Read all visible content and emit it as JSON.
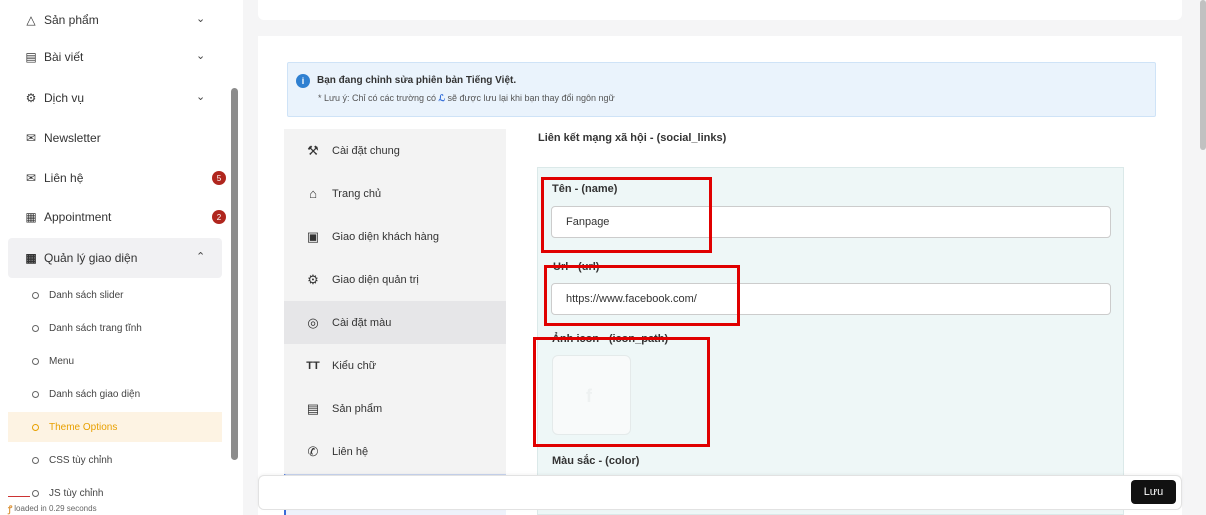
{
  "sidebar": {
    "items": [
      {
        "label": "Sản phẩm",
        "icon": "shapes-icon"
      },
      {
        "label": "Bài viết",
        "icon": "article-icon"
      },
      {
        "label": "Dịch vụ",
        "icon": "services-icon"
      },
      {
        "label": "Newsletter",
        "icon": "mail-icon"
      },
      {
        "label": "Liên hệ",
        "icon": "mail-icon",
        "badge": "5"
      },
      {
        "label": "Appointment",
        "icon": "calendar-icon",
        "badge": "2"
      },
      {
        "label": "Quản lý giao diện",
        "icon": "grid-icon"
      }
    ],
    "subitems": [
      "Danh sách slider",
      "Danh sách trang tĩnh",
      "Menu",
      "Danh sách giao diện",
      "Theme Options",
      "CSS tùy chỉnh",
      "JS tùy chỉnh"
    ],
    "active_subitem": "Theme Options",
    "loaded_text": "loaded in 0.29 seconds"
  },
  "info": {
    "title": "Bạn đang chỉnh sửa phiên bản Tiếng Việt.",
    "note_prefix": "* Lưu ý: Chỉ có các trường có",
    "note_suffix": "sẽ được lưu lại khi bạn thay đổi ngôn ngữ"
  },
  "settings_nav": [
    {
      "label": "Cài đặt chung",
      "icon": "wrench-icon"
    },
    {
      "label": "Trang chủ",
      "icon": "home-icon"
    },
    {
      "label": "Giao diện khách hàng",
      "icon": "image-icon"
    },
    {
      "label": "Giao diện quản trị",
      "icon": "settings-box-icon"
    },
    {
      "label": "Cài đặt màu",
      "icon": "palette-icon"
    },
    {
      "label": "Kiểu chữ",
      "icon": "typography-icon"
    },
    {
      "label": "Sản phẩm",
      "icon": "archive-icon"
    },
    {
      "label": "Liên hệ",
      "icon": "phone-icon"
    }
  ],
  "form": {
    "section_title": "Liên kết mạng xã hội - (social_links)",
    "name_label": "Tên - (name)",
    "name_value": "Fanpage",
    "url_label": "Url - (url)",
    "url_value": "https://www.facebook.com/",
    "icon_label": "Ảnh icon - (icon_path)",
    "color_label": "Màu sắc - (color)"
  },
  "actions": {
    "save_label": "Lưu"
  },
  "colors": {
    "accent": "#e8a000",
    "badge": "#b0261e",
    "highlight_box": "#e00000",
    "info_bg": "#eaf3fc"
  }
}
